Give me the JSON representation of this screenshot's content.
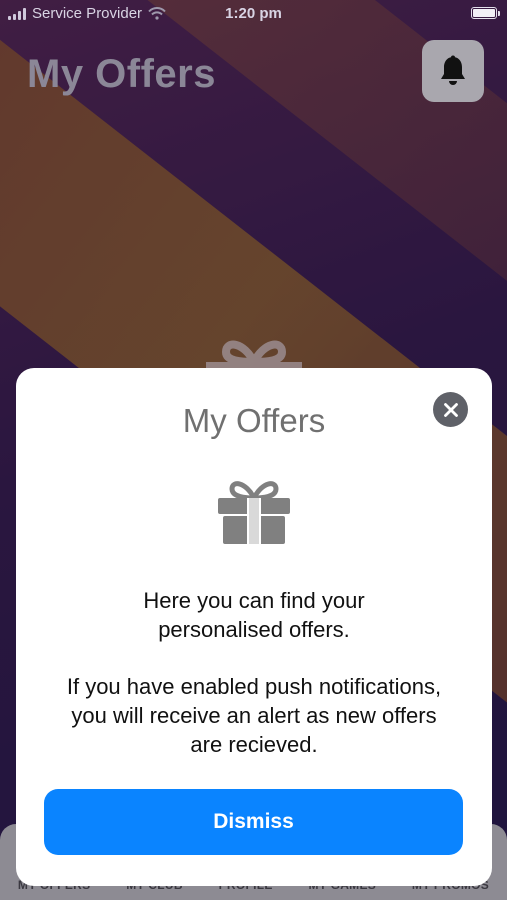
{
  "status_bar": {
    "carrier": "Service Provider",
    "time": "1:20 pm"
  },
  "header": {
    "title": "My Offers",
    "notification_icon": "bell-icon"
  },
  "tab_bar": {
    "tabs": [
      "MY OFFERS",
      "MY CLUB",
      "PROFILE",
      "MY GAMES",
      "MY PROMOS"
    ]
  },
  "modal": {
    "title": "My Offers",
    "icon": "gift-icon",
    "message_line1": "Here you can find your",
    "message_line2": "personalised offers.",
    "message_line3": "If you have enabled push notifications,",
    "message_line4": "you will receive an alert as new offers",
    "message_line5": "are recieved.",
    "dismiss_label": "Dismiss",
    "close_icon": "close-icon"
  },
  "colors": {
    "accent": "#0a84ff",
    "modal_bg": "#ffffff",
    "title_gray": "#707070"
  }
}
